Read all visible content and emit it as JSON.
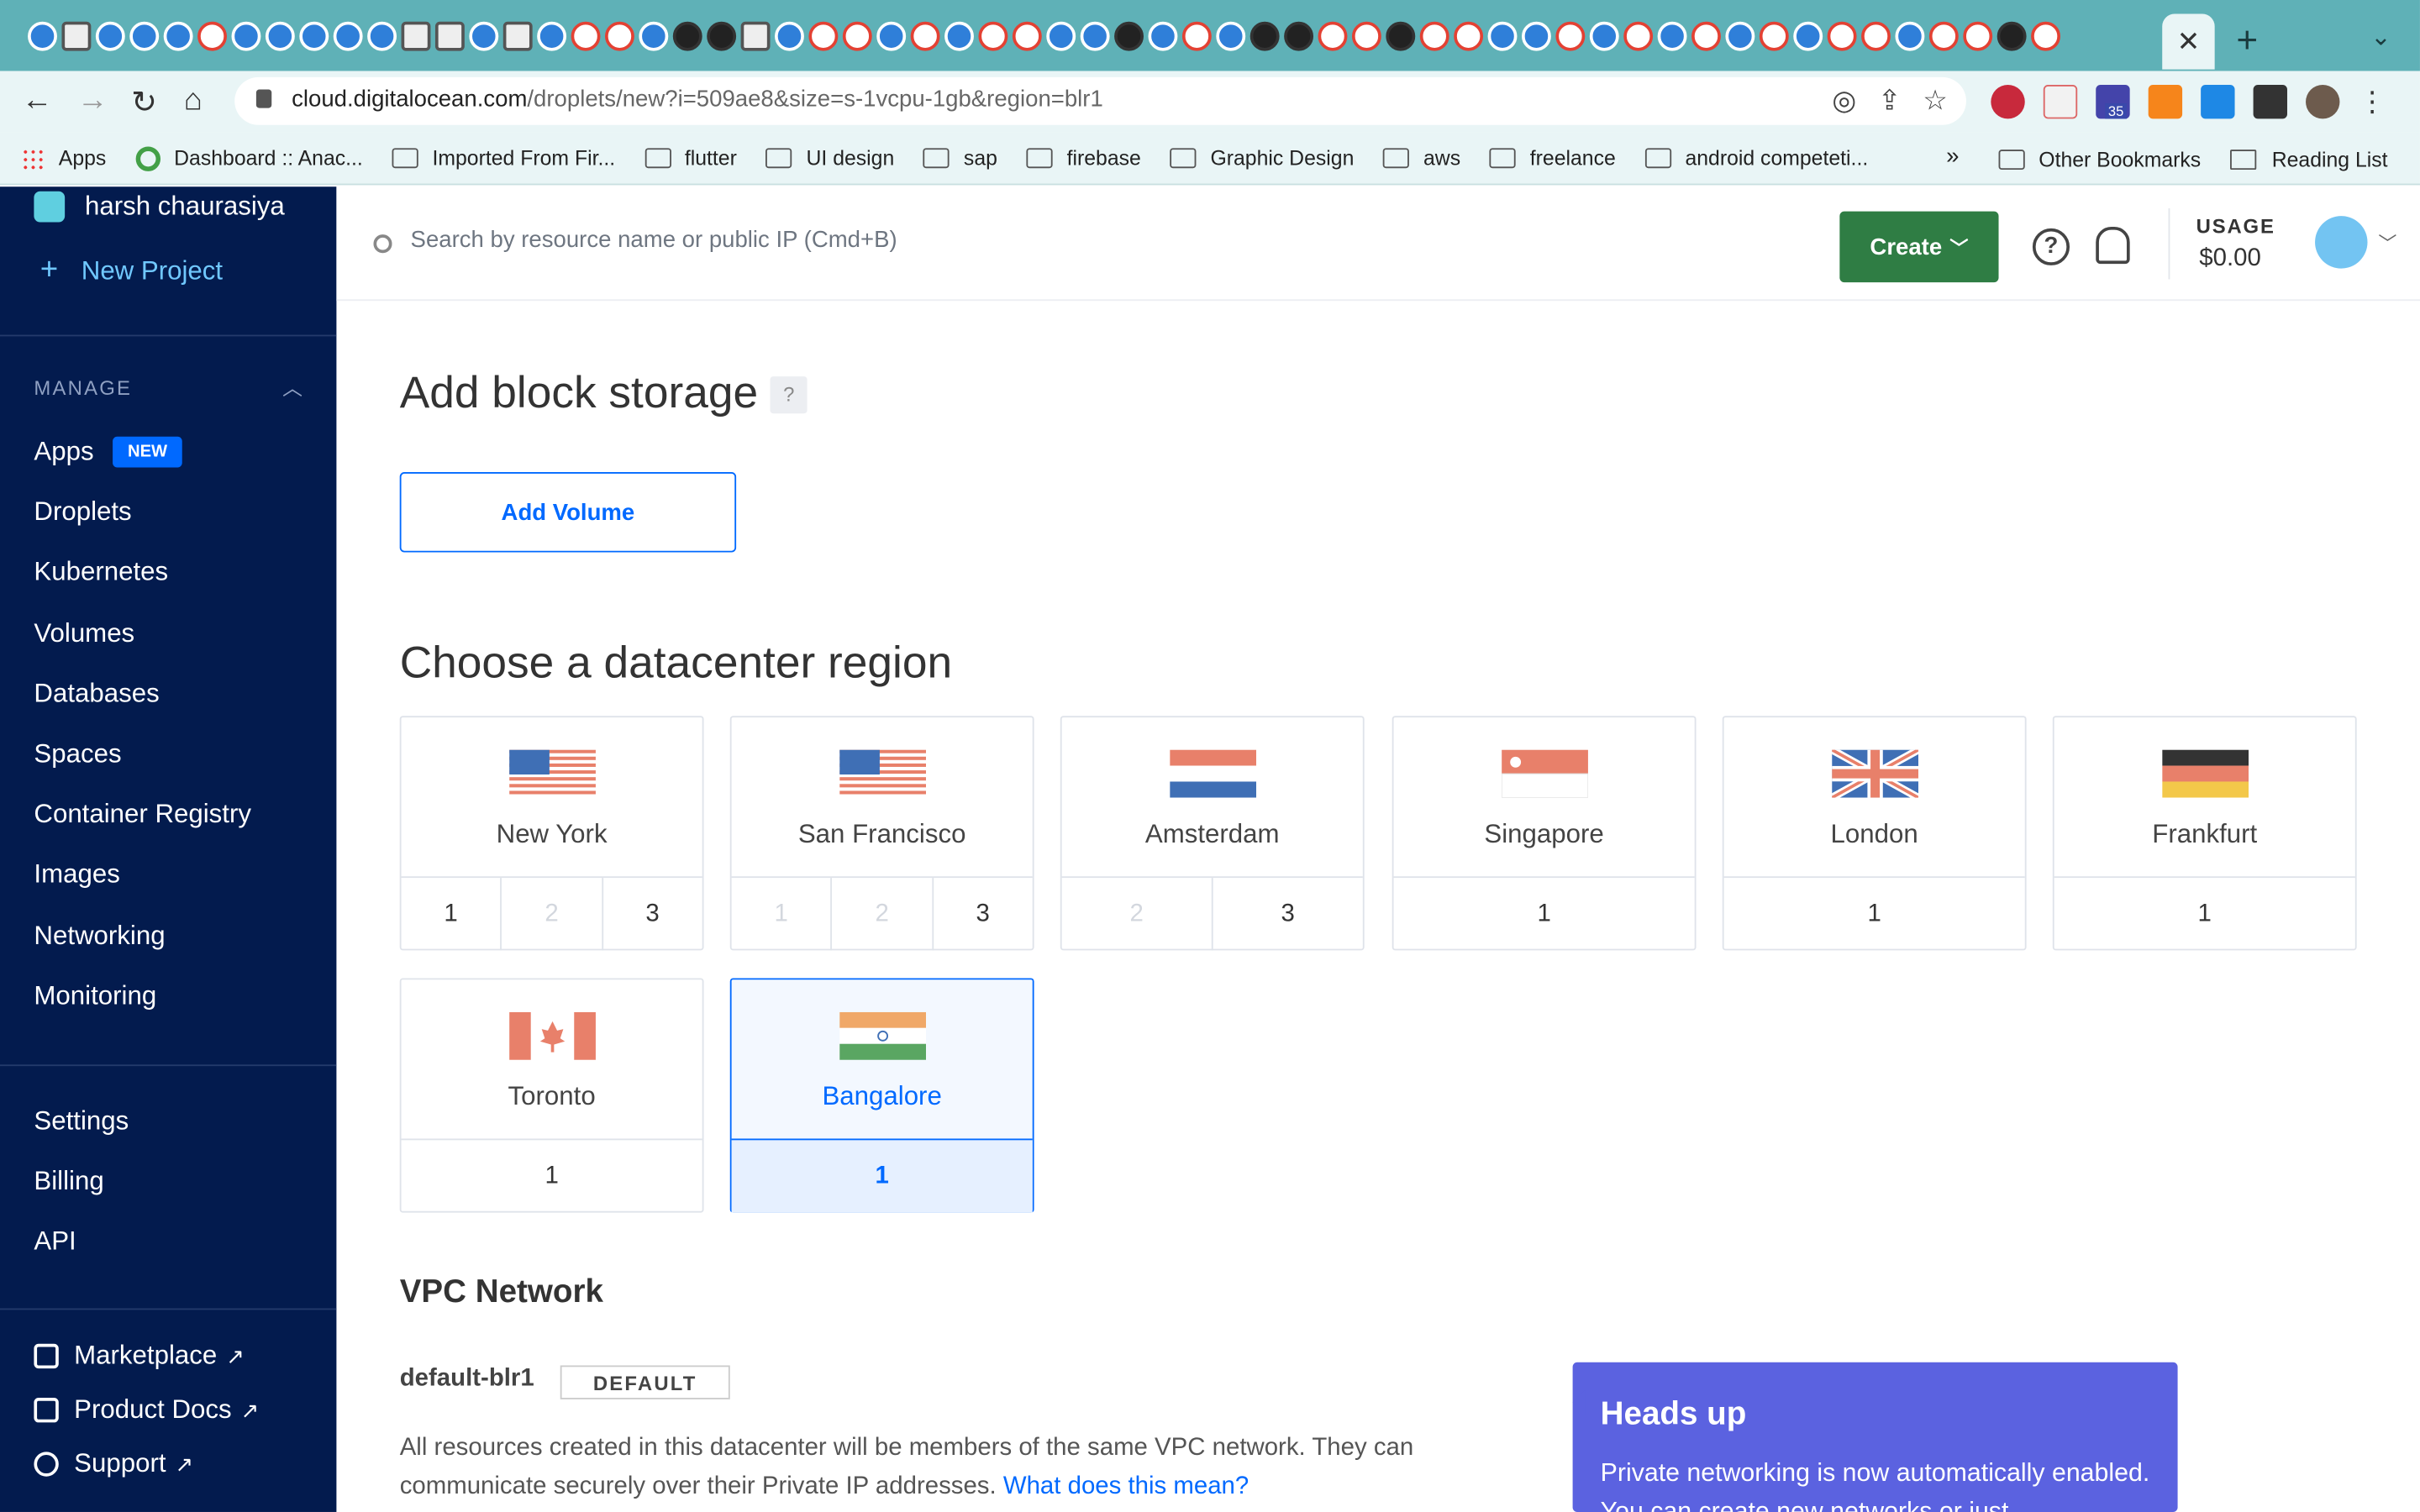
{
  "browser": {
    "url_host": "cloud.digitalocean.com",
    "url_path": "/droplets/new?i=509ae8&size=s-1vcpu-1gb&region=blr1",
    "active_tab_close": "✕",
    "new_tab": "+",
    "ext_badge": "35",
    "bookmarks": [
      {
        "label": "Apps",
        "icon": "apps-grid-icon"
      },
      {
        "label": "Dashboard :: Anac...",
        "icon": "ring-icon"
      },
      {
        "label": "Imported From Fir...",
        "icon": "folder-icon"
      },
      {
        "label": "flutter",
        "icon": "folder-icon"
      },
      {
        "label": "UI design",
        "icon": "folder-icon"
      },
      {
        "label": "sap",
        "icon": "folder-icon"
      },
      {
        "label": "firebase",
        "icon": "folder-icon"
      },
      {
        "label": "Graphic Design",
        "icon": "folder-icon"
      },
      {
        "label": "aws",
        "icon": "folder-icon"
      },
      {
        "label": "freelance",
        "icon": "folder-icon"
      },
      {
        "label": "android competeti...",
        "icon": "folder-icon"
      }
    ],
    "bookmarks_more": "»",
    "other_bookmarks": "Other Bookmarks",
    "reading_list": "Reading List"
  },
  "sidebar": {
    "user_name": "harsh chaurasiya",
    "new_project": "New Project",
    "manage_heading": "MANAGE",
    "items": [
      {
        "label": "Apps",
        "badge": "NEW"
      },
      {
        "label": "Droplets"
      },
      {
        "label": "Kubernetes"
      },
      {
        "label": "Volumes"
      },
      {
        "label": "Databases"
      },
      {
        "label": "Spaces"
      },
      {
        "label": "Container Registry"
      },
      {
        "label": "Images"
      },
      {
        "label": "Networking"
      },
      {
        "label": "Monitoring"
      }
    ],
    "account_items": [
      {
        "label": "Settings"
      },
      {
        "label": "Billing"
      },
      {
        "label": "API"
      }
    ],
    "external_items": [
      {
        "label": "Marketplace"
      },
      {
        "label": "Product Docs"
      },
      {
        "label": "Support"
      }
    ]
  },
  "topbar": {
    "search_placeholder": "Search by resource name or public IP (Cmd+B)",
    "create_label": "Create",
    "usage_label": "USAGE",
    "usage_value": "$0.00"
  },
  "main": {
    "block_storage_title": "Add block storage",
    "help_mark": "?",
    "add_volume_label": "Add Volume",
    "region_title": "Choose a datacenter region",
    "regions": [
      {
        "name": "New York",
        "flag": "us-flag",
        "dcs": [
          {
            "n": "1",
            "enabled": true
          },
          {
            "n": "2",
            "enabled": false
          },
          {
            "n": "3",
            "enabled": true
          }
        ],
        "selected": false
      },
      {
        "name": "San Francisco",
        "flag": "us-flag",
        "dcs": [
          {
            "n": "1",
            "enabled": false
          },
          {
            "n": "2",
            "enabled": false
          },
          {
            "n": "3",
            "enabled": true
          }
        ],
        "selected": false
      },
      {
        "name": "Amsterdam",
        "flag": "nl-flag",
        "dcs": [
          {
            "n": "2",
            "enabled": false
          },
          {
            "n": "3",
            "enabled": true
          }
        ],
        "selected": false
      },
      {
        "name": "Singapore",
        "flag": "sg-flag",
        "dcs": [
          {
            "n": "1",
            "enabled": true
          }
        ],
        "selected": false
      },
      {
        "name": "London",
        "flag": "uk-flag",
        "dcs": [
          {
            "n": "1",
            "enabled": true
          }
        ],
        "selected": false
      },
      {
        "name": "Frankfurt",
        "flag": "de-flag",
        "dcs": [
          {
            "n": "1",
            "enabled": true
          }
        ],
        "selected": false
      },
      {
        "name": "Toronto",
        "flag": "ca-flag",
        "dcs": [
          {
            "n": "1",
            "enabled": true
          }
        ],
        "selected": false
      },
      {
        "name": "Bangalore",
        "flag": "in-flag",
        "dcs": [
          {
            "n": "1",
            "enabled": true
          }
        ],
        "selected": true
      }
    ],
    "vpc_title": "VPC Network",
    "vpc_name": "default-blr1",
    "vpc_badge": "DEFAULT",
    "vpc_desc": "All resources created in this datacenter will be members of the same VPC network. They can communicate securely over their Private IP addresses.",
    "vpc_link": "What does this mean?",
    "heads_up_title": "Heads up",
    "heads_up_body": "Private networking is now automatically enabled. You can create new networks or just"
  },
  "colors": {
    "sidebar_bg": "#031b4e",
    "accent_blue": "#0069ff",
    "create_green": "#2f7d44",
    "heads_up_purple": "#5b62e0",
    "chrome_tab_bg": "#5fb1b7"
  }
}
